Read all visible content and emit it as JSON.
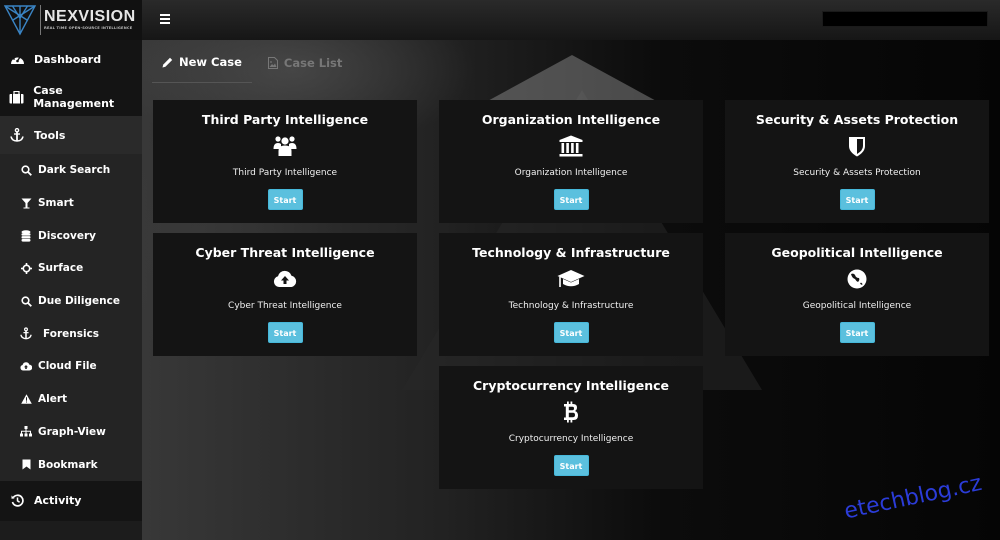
{
  "app": {
    "name": "NEXVISION",
    "tagline": "REAL TIME OPEN-SOURCE INTELLIGENCE",
    "accent_color": "#5bc0de",
    "logo_color": "#3a84c4"
  },
  "header": {
    "menu_icon": "hamburger-icon",
    "search_value": ""
  },
  "sidebar": {
    "items": [
      {
        "label": "Dashboard",
        "icon": "dashboard-gauge-icon"
      },
      {
        "label": "Case Management",
        "icon": "briefcase-icon"
      },
      {
        "label": "Tools",
        "icon": "anchor-icon"
      }
    ],
    "tools_sub": [
      {
        "label": "Dark Search",
        "icon": "search-icon"
      },
      {
        "label": "Smart",
        "icon": "glass-filter-icon"
      },
      {
        "label": "Discovery",
        "icon": "database-icon"
      },
      {
        "label": "Surface",
        "icon": "crosshairs-icon"
      },
      {
        "label": "Due Diligence",
        "icon": "search-icon"
      },
      {
        "label": "Forensics",
        "icon": "anchor-icon"
      },
      {
        "label": "Cloud File",
        "icon": "cloud-upload-icon"
      },
      {
        "label": "Alert",
        "icon": "warning-icon"
      },
      {
        "label": "Graph-View",
        "icon": "sitemap-icon"
      },
      {
        "label": "Bookmark",
        "icon": "bookmark-icon"
      }
    ],
    "activity": {
      "label": "Activity",
      "icon": "history-icon"
    }
  },
  "tabs": [
    {
      "label": "New Case",
      "icon": "pencil-icon",
      "active": true
    },
    {
      "label": "Case List",
      "icon": "file-image-icon",
      "active": false
    }
  ],
  "cards": [
    {
      "title": "Third Party Intelligence",
      "description": "Third Party Intelligence",
      "icon": "users-icon",
      "button": "Start"
    },
    {
      "title": "Organization Intelligence",
      "description": "Organization Intelligence",
      "icon": "institution-icon",
      "button": "Start"
    },
    {
      "title": "Security & Assets Protection",
      "description": "Security & Assets Protection",
      "icon": "shield-icon",
      "button": "Start"
    },
    {
      "title": "Cyber Threat Intelligence",
      "description": "Cyber Threat Intelligence",
      "icon": "cloud-upload-icon",
      "button": "Start"
    },
    {
      "title": "Technology & Infrastructure",
      "description": "Technology & Infrastructure",
      "icon": "graduation-cap-icon",
      "button": "Start"
    },
    {
      "title": "Geopolitical Intelligence",
      "description": "Geopolitical Intelligence",
      "icon": "globe-icon",
      "button": "Start"
    },
    {
      "title": "Cryptocurrency Intelligence",
      "description": "Cryptocurrency Intelligence",
      "icon": "bitcoin-icon",
      "button": "Start"
    }
  ],
  "watermark": "etechblog.cz"
}
